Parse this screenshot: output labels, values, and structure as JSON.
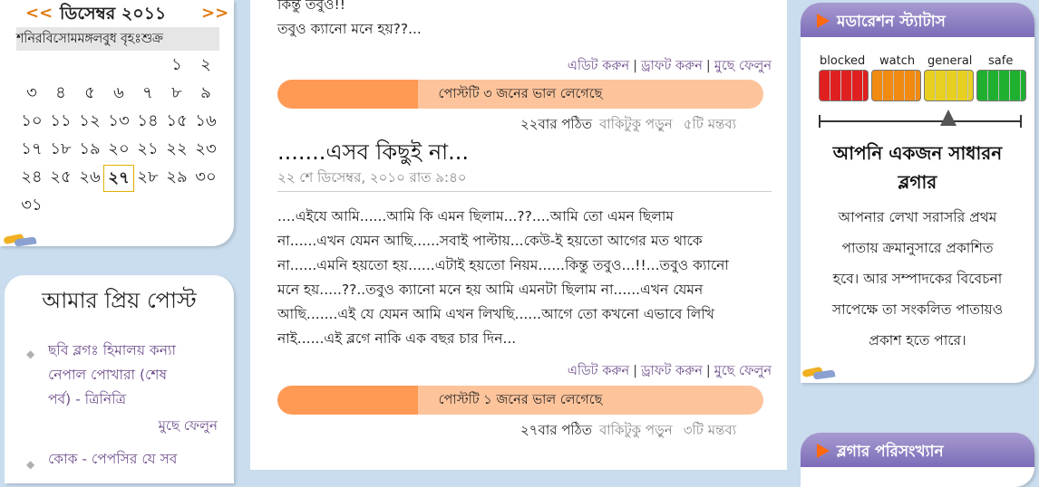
{
  "calendar": {
    "prev": "<<",
    "next": ">>",
    "month": "ডিসেম্বর ২০১১",
    "weekdays": "শনিরবিসোমমঙ্গলবুধ বৃহঃশুক্র",
    "days": [
      "১",
      "২",
      "৩",
      "৪",
      "৫",
      "৬",
      "৭",
      "৮",
      "৯",
      "১০",
      "১১",
      "১২",
      "১৩",
      "১৪",
      "১৫",
      "১৬",
      "১৭",
      "১৮",
      "১৯",
      "২০",
      "২১",
      "২২",
      "২৩",
      "২৪",
      "২৫",
      "২৬",
      "২৭",
      "২৮",
      "২৯",
      "৩০",
      "৩১"
    ],
    "today": "২৭"
  },
  "favorites": {
    "title": "আমার প্রিয় পোস্ট",
    "items": [
      {
        "line1": "ছবি ব্লগঃ হিমালয় কন্যা",
        "line2": "নেপাল  পোখারা (শেষ",
        "line3": "পর্ব) - ত্রিনিত্রি",
        "delete": "মুছে ফেলুন"
      },
      {
        "line1": "কোক - পেপসির যে সব"
      }
    ]
  },
  "posts": [
    {
      "top_line1": "কিন্তু তবুও!!",
      "top_line2": "তবুও ক্যানো মনে হয়??...",
      "edit": "এডিট করুন",
      "draft": "ড্রাফট করুন",
      "delete": "মুছে ফেলুন",
      "like_text": "পোস্টটি ৩ জনের ভাল লেগেছে",
      "like_fraction": 0.29,
      "reads": "২২বার পঠিত",
      "read_more": "বাকিটুকু পড়ুন",
      "comments": "৫টি মন্তব্য"
    },
    {
      "title": ".......এসব কিছুই না...",
      "date": "২২ শে ডিসেম্বর, ২০১০ রাত ৯:৪০",
      "body": [
        "....এইযে আমি......আমি কি এমন ছিলাম...??....আমি তো এমন ছিলাম",
        "না......এখন যেমন আছি......সবাই পাল্টায়...কেউ-ই হয়তো আগের মত থাকে",
        "না......এমনি হয়তো হয়......এটাই হয়তো নিয়ম......কিন্তু তবুও...!!...তবুও ক্যানো",
        "মনে হয়.....??..তবুও ক্যানো মনে হয় আমি এমনটা ছিলাম না......এখন যেমন",
        "আছি.......এই যে যেমন আমি এখন লিখছি......আগে তো কখনো এভাবে লিখি",
        "নাই......এই ব্লগে নাকি এক বছর চার দিন..."
      ],
      "edit": "এডিট করুন",
      "draft": "ড্রাফট করুন",
      "delete": "মুছে ফেলুন",
      "like_text": "পোস্টটি ১ জনের ভাল লেগেছে",
      "like_fraction": 0.29,
      "reads": "২৭বার পঠিত",
      "read_more": "বাকিটুকু পড়ুন",
      "comments": "৩টি মন্তব্য"
    }
  ],
  "moderation": {
    "title": "মডারেশন স্ট্যাটাস",
    "levels": [
      {
        "label": "blocked",
        "color": "#e02020"
      },
      {
        "label": "watch",
        "color": "#f08a10"
      },
      {
        "label": "general",
        "color": "#e8d020"
      },
      {
        "label": "safe",
        "color": "#20b030"
      }
    ],
    "current": "general",
    "status_line1": "আপনি একজন সাধারন",
    "status_line2": "ব্লগার",
    "desc": [
      "আপনার লেখা সরাসরি প্রথম",
      "পাতায় ক্রমানুসারে প্রকাশিত",
      "হবে। আর সম্পাদকের বিবেচনা",
      "সাপেক্ষে তা সংকলিত পাতায়ও",
      "প্রকাশ হতে পারে।"
    ]
  },
  "blogger_stats": {
    "title": "ব্লগার পরিসংখ্যান"
  }
}
